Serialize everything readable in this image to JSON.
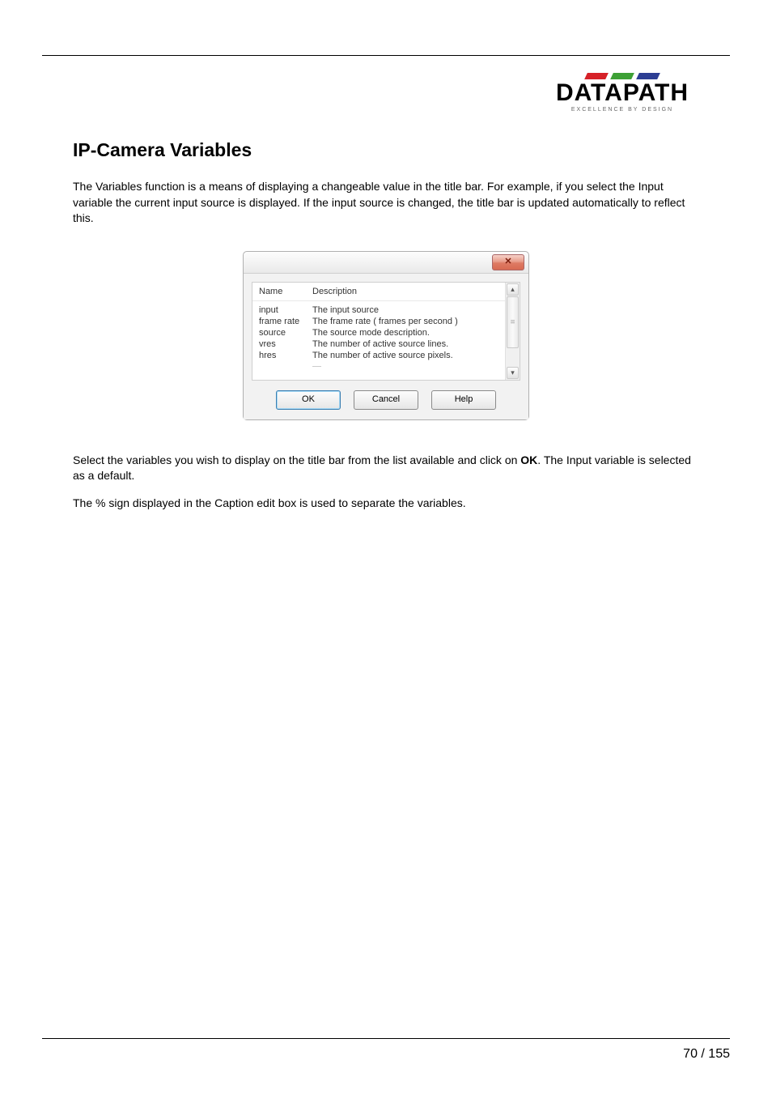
{
  "logo": {
    "name": "DATAPATH",
    "tagline": "EXCELLENCE BY DESIGN"
  },
  "heading": "IP-Camera Variables",
  "para1": "The Variables function is a means of displaying a changeable value in the title bar. For example, if you select the Input variable the current input source is displayed. If the input source is changed, the title bar is updated automatically to reflect this.",
  "para2_pre": "Select the variables you wish to display on the title bar from the list available and click on ",
  "para2_bold": "OK",
  "para2_post": ". The Input variable is selected as a default.",
  "para3": "The % sign displayed in the Caption edit box is used to separate the variables.",
  "dialog": {
    "close_glyph": "✕",
    "header": {
      "name": "Name",
      "desc": "Description"
    },
    "rows": [
      {
        "name": "input",
        "desc": "The input source"
      },
      {
        "name": "frame rate",
        "desc": "The frame rate ( frames per second )"
      },
      {
        "name": "source",
        "desc": "The source mode description."
      },
      {
        "name": "vres",
        "desc": "The number of active source lines."
      },
      {
        "name": "hres",
        "desc": "The number of active source pixels."
      }
    ],
    "buttons": {
      "ok": "OK",
      "cancel": "Cancel",
      "help": "Help"
    },
    "scroll": {
      "up": "▴",
      "down": "▾"
    }
  },
  "page_number": "70 / 155"
}
